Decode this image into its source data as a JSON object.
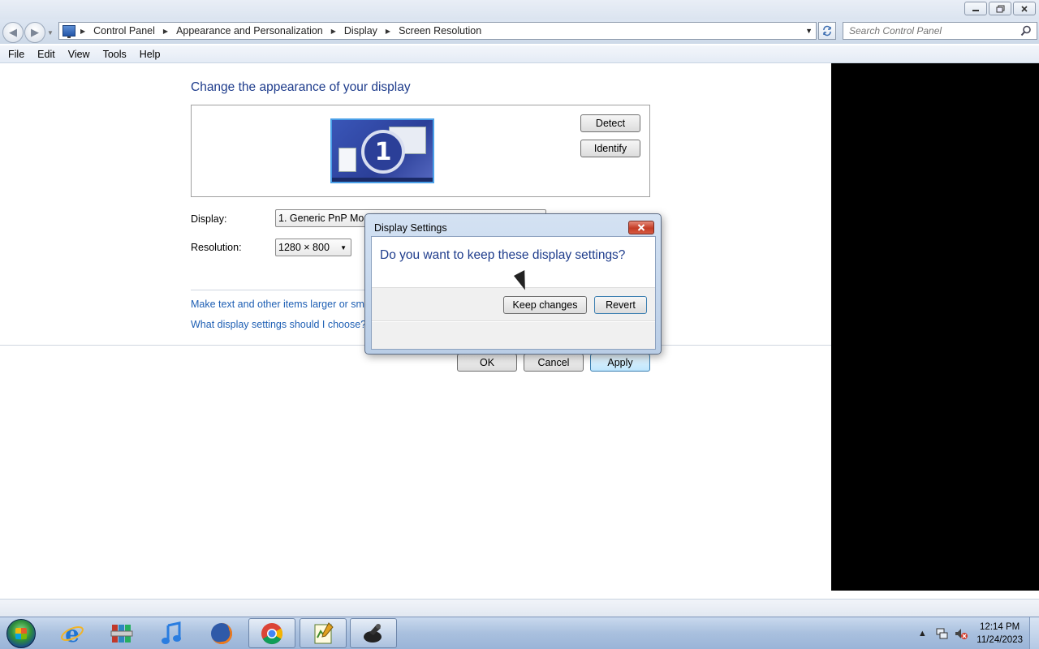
{
  "address": {
    "crumbs": [
      "Control Panel",
      "Appearance and Personalization",
      "Display",
      "Screen Resolution"
    ]
  },
  "search": {
    "placeholder": "Search Control Panel"
  },
  "menu": [
    "File",
    "Edit",
    "View",
    "Tools",
    "Help"
  ],
  "page": {
    "heading": "Change the appearance of your display",
    "monitor_number": "1",
    "detect_label": "Detect",
    "identify_label": "Identify",
    "display_label": "Display:",
    "display_value": "1. Generic PnP Monitor",
    "resolution_label": "Resolution:",
    "resolution_value": "1280 × 800",
    "link_text_size": "Make text and other items larger or smaller",
    "link_choose": "What display settings should I choose?",
    "ok_label": "OK",
    "cancel_label": "Cancel",
    "apply_label": "Apply"
  },
  "dialog": {
    "title": "Display Settings",
    "question": "Do you want to keep these display settings?",
    "keep_label": "Keep changes",
    "revert_label": "Revert"
  },
  "taskbar": {
    "items": [
      "internet-explorer",
      "archive-manager",
      "itunes",
      "firefox",
      "chrome",
      "notepad-editor",
      "system-tool"
    ],
    "time": "12:14 PM",
    "date": "11/24/2023"
  },
  "colors": {
    "heading": "#1e3c8c",
    "link": "#1e5fb4"
  }
}
